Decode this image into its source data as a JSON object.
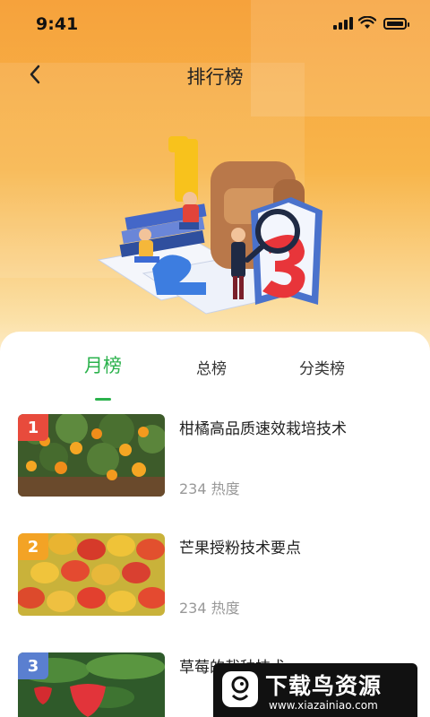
{
  "status": {
    "time": "9:41"
  },
  "header": {
    "title": "排行榜"
  },
  "tabs": [
    {
      "label": "月榜",
      "active": true
    },
    {
      "label": "总榜",
      "active": false
    },
    {
      "label": "分类榜",
      "active": false
    }
  ],
  "items": [
    {
      "rank": "1",
      "title": "柑橘高品质速效栽培技术",
      "heat": "234 热度",
      "badge_color": "#e84b3c"
    },
    {
      "rank": "2",
      "title": "芒果授粉技术要点",
      "heat": "234 热度",
      "badge_color": "#f3a325"
    },
    {
      "rank": "3",
      "title": "草莓的栽种技术",
      "heat": "",
      "badge_color": "#5a7fd0"
    }
  ],
  "watermark": {
    "title": "下载鸟资源",
    "url": "www.xiazainiao.com"
  },
  "colors": {
    "accent": "#2bb24c",
    "hero_top": "#f6a23c"
  }
}
